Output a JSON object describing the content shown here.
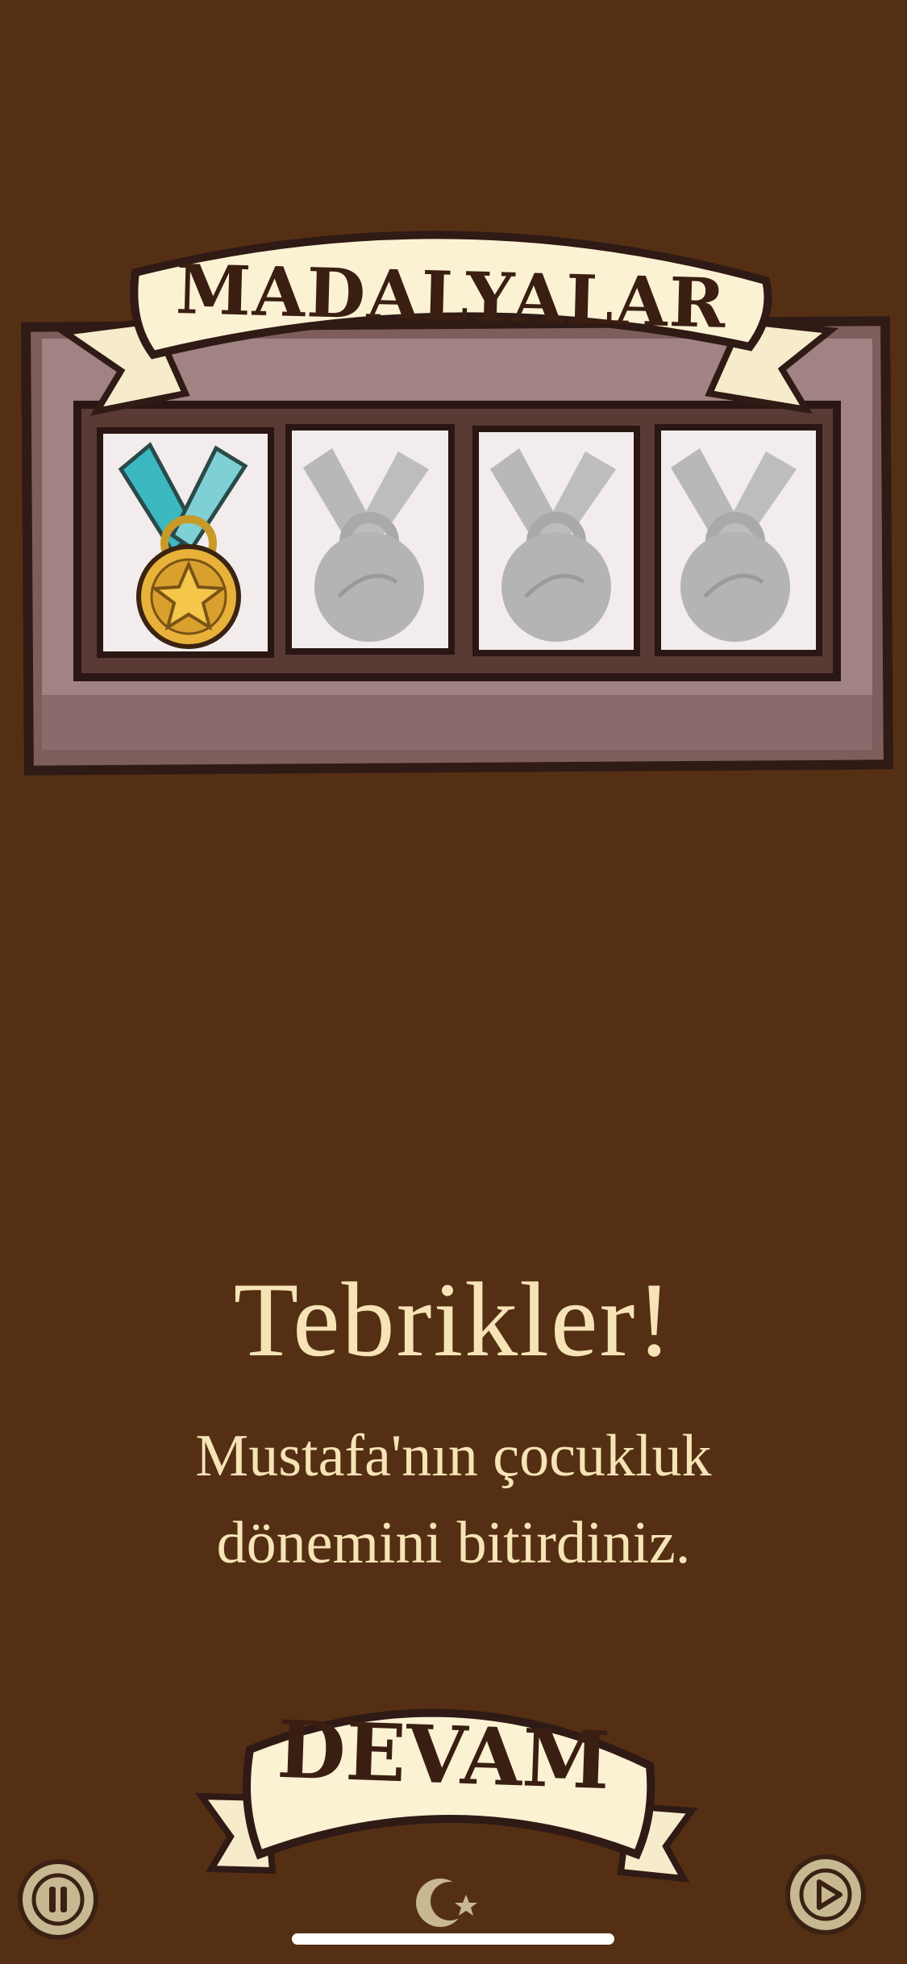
{
  "medals_panel": {
    "title": "MADALYALAR",
    "slots": [
      {
        "status": "earned",
        "icon": "gold-star-medal-icon"
      },
      {
        "status": "locked",
        "icon": "locked-medal-icon"
      },
      {
        "status": "locked",
        "icon": "locked-medal-icon"
      },
      {
        "status": "locked",
        "icon": "locked-medal-icon"
      }
    ]
  },
  "congrats": {
    "title": "Tebrikler!",
    "line1": "Mustafa'nın çocukluk",
    "line2": "dönemini bitirdiniz."
  },
  "continue_button": {
    "label": "DEVAM"
  },
  "footer": {
    "pause_icon": "pause-icon",
    "logo_icon": "crescent-star-icon",
    "play_icon": "play-icon"
  },
  "colors": {
    "background": "#552f14",
    "panel": "#8a6a6a",
    "banner": "#fbf1d3",
    "text_light": "#f6e4b6",
    "outline": "#3a1e12",
    "ribbon": "#3cb8c0",
    "gold": "#e8b23a",
    "locked": "#b8b8b8"
  }
}
